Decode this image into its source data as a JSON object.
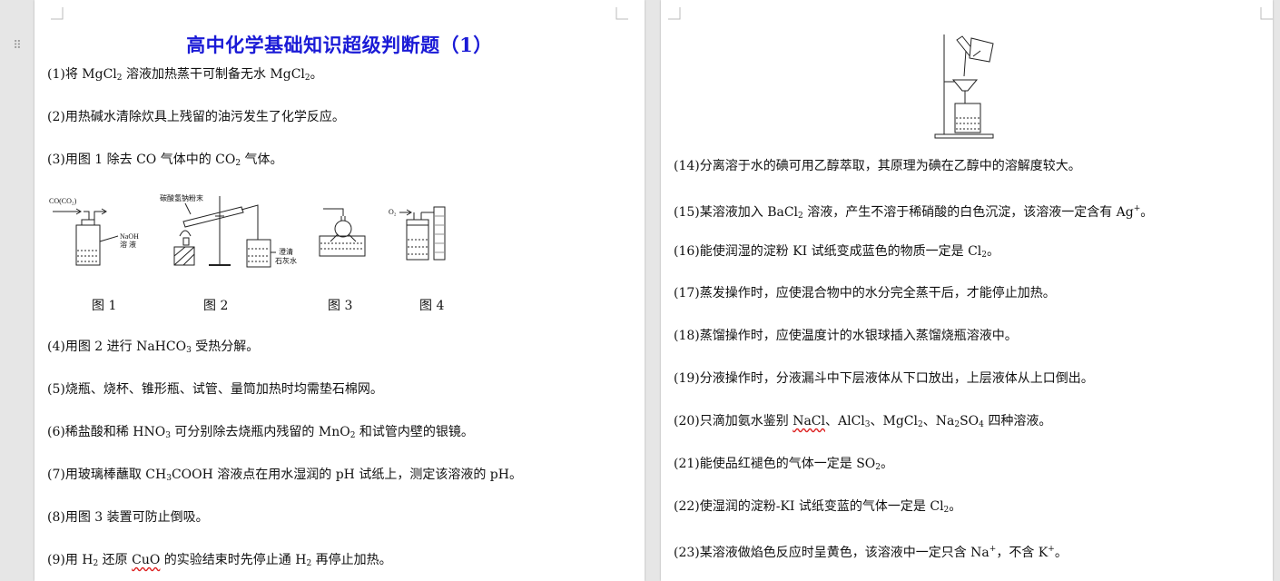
{
  "left_page": {
    "title": "高中化学基础知识超级判断题（1）",
    "questions": {
      "q1": {
        "a": "(1)将 MgCl",
        "b": "2",
        "c": " 溶液加热蒸干可制备无水 MgCl",
        "d": "2",
        "e": "。"
      },
      "q2": "(2)用热碱水清除炊具上残留的油污发生了化学反应。",
      "q3": {
        "a": "(3)用图 1 除去 CO 气体中的 CO",
        "b": "2",
        "c": " 气体。"
      },
      "q4": {
        "a": "(4)用图 2 进行 NaHCO",
        "b": "3",
        "c": " 受热分解。"
      },
      "q5": "(5)烧瓶、烧杯、锥形瓶、试管、量筒加热时均需垫石棉网。",
      "q6": {
        "a": "(6)稀盐酸和稀 HNO",
        "b": "3",
        "c": " 可分别除去烧瓶内残留的 MnO",
        "d": "2",
        "e": " 和试管内壁的银镜。"
      },
      "q7": {
        "a": "(7)用玻璃棒蘸取 CH",
        "b": "3",
        "c": "COOH 溶液点在用水湿润的 pH 试纸上，测定该溶液的 pH。"
      },
      "q8": "(8)用图 3 装置可防止倒吸。",
      "q9": {
        "a": "(9)用 H",
        "b": "2",
        "c": " 还原 ",
        "d": "CuO",
        "e": " 的实验结束时先停止通 H",
        "f": "2",
        "g": " 再停止加热。"
      }
    },
    "figure": {
      "labels": [
        "图 1",
        "图 2",
        "图 3",
        "图 4"
      ],
      "fig1_gas": "CO(CO₂)",
      "fig1_naoh": "NaOH",
      "fig1_solution": "溶 液",
      "fig2_powder": "碳酸氢钠粉末",
      "fig2_lime1": "澄清",
      "fig2_lime2": "石灰水",
      "fig4_gas": "O₂"
    }
  },
  "right_page": {
    "questions": {
      "q14": "(14)分离溶于水的碘可用乙醇萃取，其原理为碘在乙醇中的溶解度较大。",
      "q15": {
        "a": "(15)某溶液加入 BaCl",
        "b": "2",
        "c": " 溶液，产生不溶于稀硝酸的白色沉淀，该溶液一定含有 Ag",
        "d": "+",
        "e": "。"
      },
      "q16": {
        "a": "(16)能使润湿的淀粉 KI 试纸变成蓝色的物质一定是 Cl",
        "b": "2",
        "c": "。"
      },
      "q17": "(17)蒸发操作时，应使混合物中的水分完全蒸干后，才能停止加热。",
      "q18": "(18)蒸馏操作时，应使温度计的水银球插入蒸馏烧瓶溶液中。",
      "q19": "(19)分液操作时，分液漏斗中下层液体从下口放出，上层液体从上口倒出。",
      "q20": {
        "a": "(20)只滴加氨水鉴别 ",
        "b": "NaCl",
        "c": "、AlCl",
        "d": "3",
        "e": "、MgCl",
        "f": "2",
        "g": "、Na",
        "h": "2",
        "i": "SO",
        "j": "4",
        "k": " 四种溶液。"
      },
      "q21": {
        "a": "(21)能使品红褪色的气体一定是 SO",
        "b": "2",
        "c": "。"
      },
      "q22": {
        "a": "(22)使湿润的淀粉-KI 试纸变蓝的气体一定是 Cl",
        "b": "2",
        "c": "。"
      },
      "q23": {
        "a": "(23)某溶液做焰色反应时呈黄色，该溶液中一定只含 Na",
        "b": "+",
        "c": "，不含 K",
        "d": "+",
        "e": "。"
      }
    }
  }
}
